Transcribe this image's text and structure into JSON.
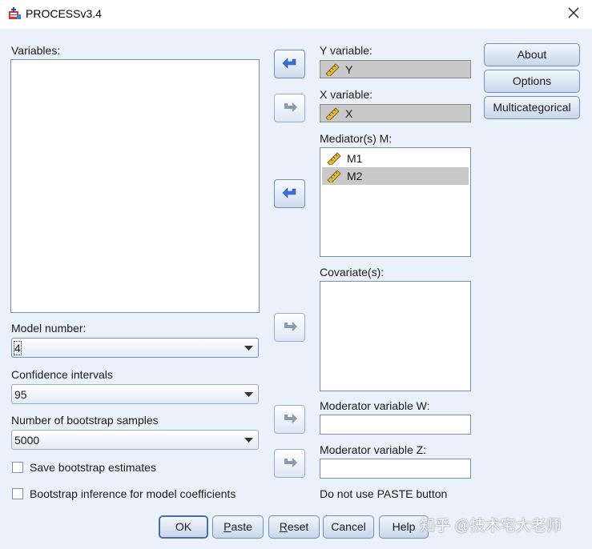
{
  "window": {
    "title": "PROCESSv3.4"
  },
  "variables_panel": {
    "label": "Variables:"
  },
  "y_variable": {
    "label": "Y variable:",
    "value": "Y"
  },
  "x_variable": {
    "label": "X variable:",
    "value": "X"
  },
  "mediators": {
    "label": "Mediator(s) M:",
    "items": [
      "M1",
      "M2"
    ],
    "selected": "M2"
  },
  "covariates": {
    "label": "Covariate(s):"
  },
  "moderator_w": {
    "label": "Moderator variable W:",
    "value": ""
  },
  "moderator_z": {
    "label": "Moderator variable Z:",
    "value": ""
  },
  "paste_note": "Do not use PASTE button",
  "side_buttons": {
    "about": "About",
    "options": "Options",
    "multicategorical": "Multicategorical"
  },
  "model_number": {
    "label": "Model number:",
    "value": "4"
  },
  "confidence": {
    "label": "Confidence intervals",
    "value": "95"
  },
  "bootstrap": {
    "label": "Number of bootstrap samples",
    "value": "5000"
  },
  "checkboxes": {
    "save_estimates": {
      "label": "Save bootstrap estimates",
      "checked": false
    },
    "inference_coefficients": {
      "label": "Bootstrap inference for model coefficients",
      "checked": false
    }
  },
  "bottom_buttons": {
    "ok": "OK",
    "paste_first": "P",
    "paste_rest": "aste",
    "reset_first": "R",
    "reset_rest": "eset",
    "cancel": "Cancel",
    "help": "Help"
  },
  "watermark": "知乎 @技术宅大老师",
  "colors": {
    "dialog_bg": "#ebf1fa",
    "selected_row": "#c9c9c9",
    "arrow_blue": "#3a6fd8",
    "arrow_grey": "#8a99ad"
  }
}
